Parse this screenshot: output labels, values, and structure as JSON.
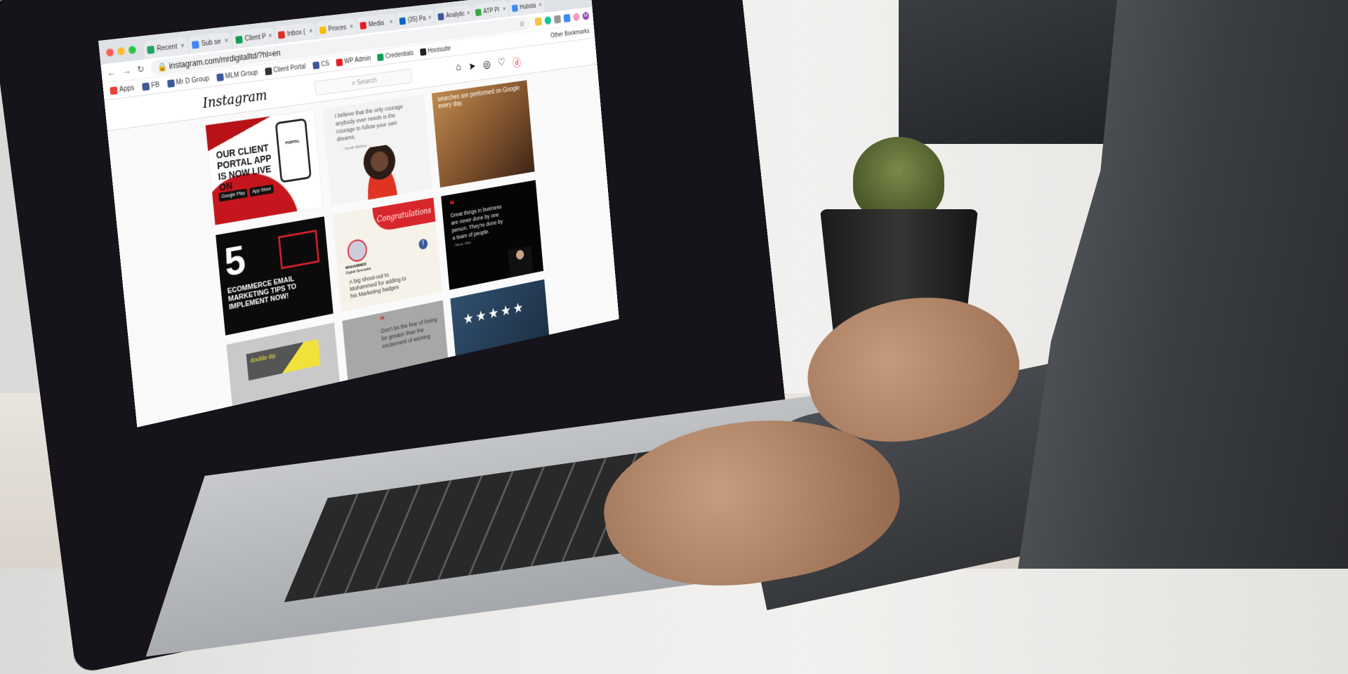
{
  "browser": {
    "tabs": [
      {
        "label": "Recent",
        "icon": "google-drive-icon",
        "color": "#1fa463"
      },
      {
        "label": "Sub se",
        "icon": "google-docs-icon",
        "color": "#4285f4"
      },
      {
        "label": "Client P",
        "icon": "google-sheets-icon",
        "color": "#0f9d58"
      },
      {
        "label": "Inbox (",
        "icon": "gmail-icon",
        "color": "#d93025"
      },
      {
        "label": "Proces",
        "icon": "google-drive-icon",
        "color": "#fbbc04"
      },
      {
        "label": "Media",
        "icon": "d-logo-icon",
        "color": "#e31e24"
      },
      {
        "label": "(35) Pa",
        "icon": "linkedin-icon",
        "color": "#0a66c2"
      },
      {
        "label": "Analytic",
        "icon": "facebook-icon",
        "color": "#3b5998"
      },
      {
        "label": "ATP Pl",
        "icon": "leaf-icon",
        "color": "#3aa845"
      },
      {
        "label": "Hubsta",
        "icon": "hubstaff-icon",
        "color": "#3d8af7"
      }
    ],
    "url": "instagram.com/mrdigitalltd/?hl=en",
    "other_bookmarks": "Other Bookmarks",
    "profile_initial": "M",
    "bookmarks": [
      {
        "label": "Apps",
        "icon": "apps-grid-icon",
        "color": "#ea4335"
      },
      {
        "label": "FB",
        "icon": "facebook-icon",
        "color": "#3b5998"
      },
      {
        "label": "Mr D Group",
        "icon": "facebook-icon",
        "color": "#3b5998"
      },
      {
        "label": "MLM Group",
        "icon": "facebook-icon",
        "color": "#3b5998"
      },
      {
        "label": "Client Portal",
        "icon": "globe-icon",
        "color": "#333333"
      },
      {
        "label": "CS",
        "icon": "facebook-icon",
        "color": "#3b5998"
      },
      {
        "label": "WP Admin",
        "icon": "d-logo-icon",
        "color": "#e31e24"
      },
      {
        "label": "Credentials",
        "icon": "google-sheets-icon",
        "color": "#0f9d58"
      },
      {
        "label": "Hootsuite",
        "icon": "hootsuite-icon",
        "color": "#222222"
      }
    ]
  },
  "instagram": {
    "logo": "Instagram",
    "search_placeholder": "Search",
    "nav_icons": [
      "home-icon",
      "direct-icon",
      "explore-icon",
      "heart-icon",
      "profile-icon"
    ],
    "posts": {
      "p1": {
        "title": "OUR CLIENT PORTAL APP IS NOW LIVE ON",
        "google": "Google Play",
        "apple": "App Store",
        "phone": "PORTAL"
      },
      "p2": {
        "quote": "I believe that the only courage anybody ever needs is the courage to follow your own dreams.",
        "author": "- Oprah Winfrey"
      },
      "p3": {
        "text": "searches are performed on Google every day."
      },
      "p4": {
        "number": "5",
        "text": "ECOMMERCE EMAIL MARKETING TIPS TO IMPLEMENT NOW!"
      },
      "p5": {
        "banner": "Congratulations",
        "name": "MOHAMMED",
        "role": "Digital Specialist",
        "message": "A big shout-out to Mohammed for adding to his Marketing badges"
      },
      "p6": {
        "quote": "Great things in business are never done by one person. They're done by a team of people.",
        "author": "- Steve Jobs"
      },
      "p7": {
        "text": "double dip"
      },
      "p8": {
        "quote": "Don't let the fear of losing be greater than the excitement of winning"
      },
      "p9": {
        "stars": "★★★★★"
      }
    }
  },
  "colors": {
    "brand_red": "#d8272c",
    "instagram_border": "#dbdbdb"
  }
}
